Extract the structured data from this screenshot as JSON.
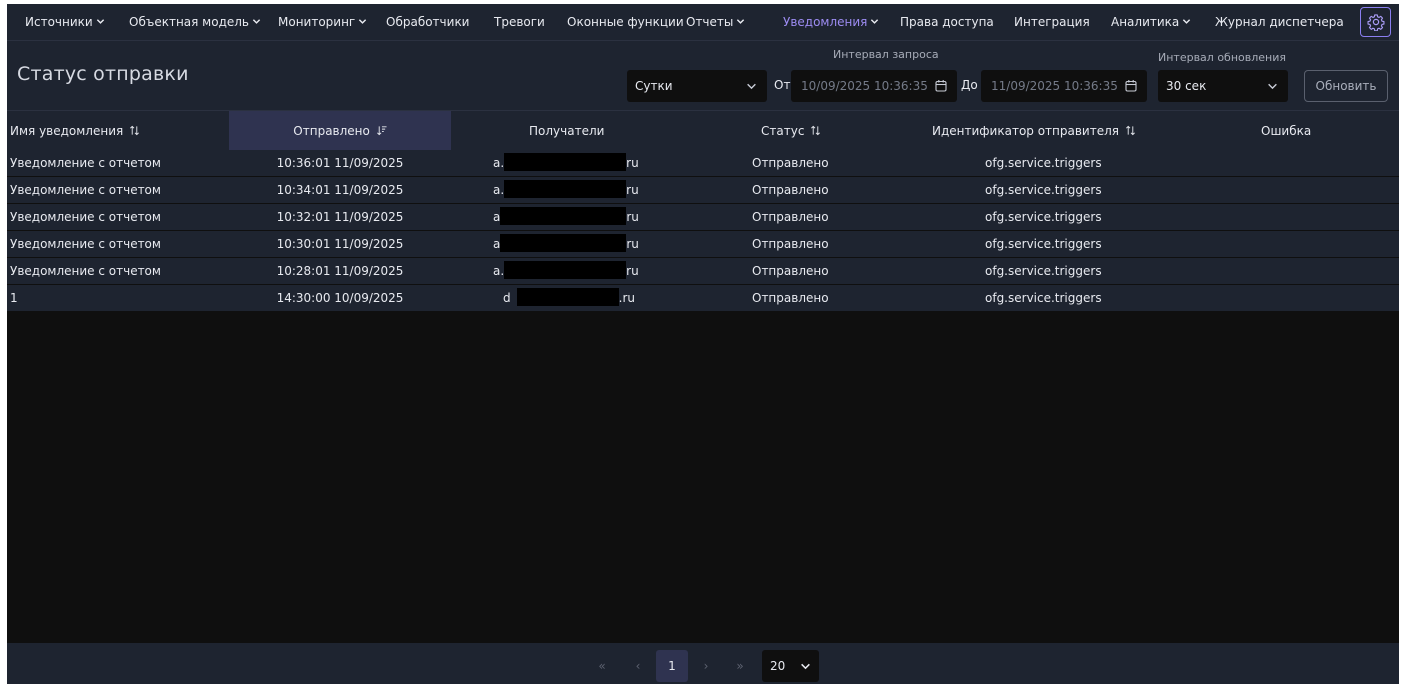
{
  "nav": {
    "items": [
      {
        "label": "Источники",
        "dropdown": true,
        "active": false
      },
      {
        "label": "Объектная модель",
        "dropdown": true,
        "active": false
      },
      {
        "label": "Мониторинг",
        "dropdown": true,
        "active": false
      },
      {
        "label": "Обработчики",
        "dropdown": false,
        "active": false
      },
      {
        "label": "Тревоги",
        "dropdown": false,
        "active": false
      },
      {
        "label": "Оконные функции",
        "dropdown": false,
        "active": false
      },
      {
        "label": "Отчеты",
        "dropdown": true,
        "active": false
      },
      {
        "label": "Уведомления",
        "dropdown": true,
        "active": true
      },
      {
        "label": "Права доступа",
        "dropdown": false,
        "active": false
      },
      {
        "label": "Интеграция",
        "dropdown": false,
        "active": false
      },
      {
        "label": "Аналитика",
        "dropdown": true,
        "active": false
      },
      {
        "label": "Журнал диспетчера",
        "dropdown": false,
        "active": false
      }
    ],
    "settings_icon": "gear-icon",
    "active_color": "#9d8cf2"
  },
  "header": {
    "title": "Статус отправки",
    "query_interval_label": "Интервал запроса",
    "period_select": "Сутки",
    "from_label": "От",
    "from_value": "10/09/2025 10:36:35",
    "to_label": "До",
    "to_value": "11/09/2025 10:36:35",
    "refresh_interval_label": "Интервал обновления",
    "refresh_interval_select": "30 сек",
    "refresh_button": "Обновить"
  },
  "table": {
    "columns": [
      {
        "label": "Имя уведомления",
        "sort": "both"
      },
      {
        "label": "Отправлено",
        "sort": "desc"
      },
      {
        "label": "Получатели",
        "sort": "none"
      },
      {
        "label": "Статус",
        "sort": "both"
      },
      {
        "label": "Идентификатор отправителя",
        "sort": "both"
      },
      {
        "label": "Ошибка",
        "sort": "none"
      }
    ],
    "rows": [
      {
        "name": "Уведомление с отчетом",
        "sent": "10:36:01 11/09/2025",
        "recipient_prefix": "a.",
        "recipient_suffix": "ru",
        "status": "Отправлено",
        "sender": "ofg.service.triggers",
        "error": ""
      },
      {
        "name": "Уведомление с отчетом",
        "sent": "10:34:01 11/09/2025",
        "recipient_prefix": "a.",
        "recipient_suffix": "ru",
        "status": "Отправлено",
        "sender": "ofg.service.triggers",
        "error": ""
      },
      {
        "name": "Уведомление с отчетом",
        "sent": "10:32:01 11/09/2025",
        "recipient_prefix": "a",
        "recipient_suffix": "ru",
        "status": "Отправлено",
        "sender": "ofg.service.triggers",
        "error": ""
      },
      {
        "name": "Уведомление с отчетом",
        "sent": "10:30:01 11/09/2025",
        "recipient_prefix": "a",
        "recipient_suffix": "ru",
        "status": "Отправлено",
        "sender": "ofg.service.triggers",
        "error": ""
      },
      {
        "name": "Уведомление с отчетом",
        "sent": "10:28:01 11/09/2025",
        "recipient_prefix": "a.",
        "recipient_suffix": "ru",
        "status": "Отправлено",
        "sender": "ofg.service.triggers",
        "error": ""
      },
      {
        "name": "1",
        "sent": "14:30:00 10/09/2025",
        "recipient_prefix": "d",
        "recipient_suffix": ".ru",
        "status": "Отправлено",
        "sender": "ofg.service.triggers",
        "error": ""
      }
    ]
  },
  "pagination": {
    "first": "«",
    "prev": "‹",
    "current_page": "1",
    "next": "›",
    "last": "»",
    "per_page": "20"
  }
}
